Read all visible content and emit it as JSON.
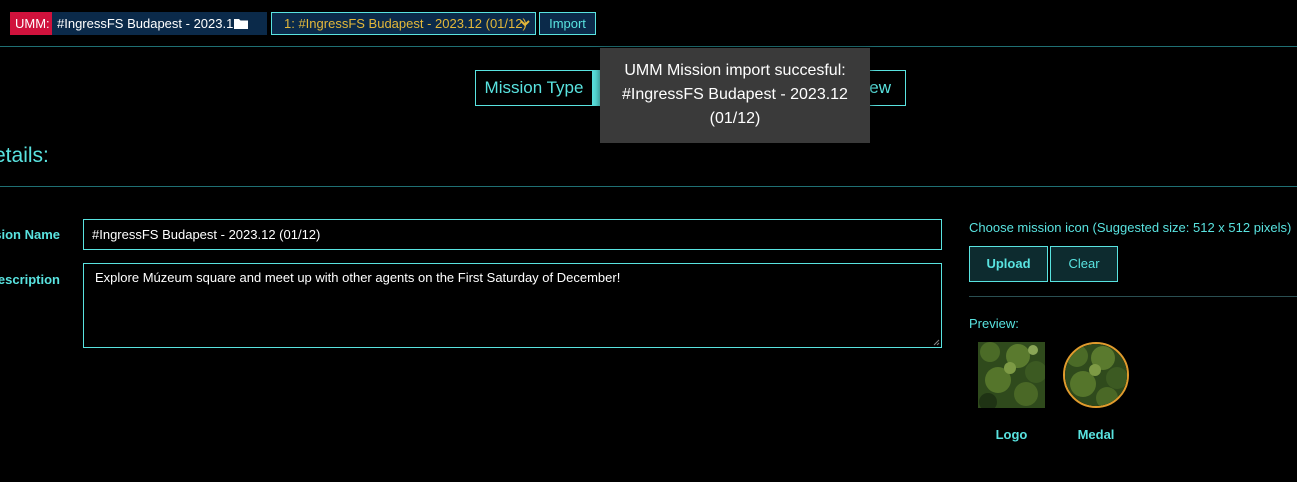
{
  "topbar": {
    "badge": "UMM:",
    "file_name": "#IngressFS Budapest - 2023.12",
    "file_icon": "folder-icon",
    "mission_select_value": "1: #IngressFS Budapest - 2023.12 (01/12)",
    "import_label": "Import"
  },
  "tabs": {
    "mission_type": "Mission Type",
    "preview_partial": "ew"
  },
  "toast": {
    "line1": "UMM Mission import succesful:",
    "line2": "#IngressFS Budapest - 2023.12",
    "line3": "(01/12)"
  },
  "details": {
    "title": "etails:",
    "name_label": "Mission Name",
    "desc_label": "Description",
    "name_value": "#IngressFS Budapest - 2023.12 (01/12)",
    "desc_value": "Explore Múzeum square and meet up with other agents on the First Saturday of December!"
  },
  "icon_panel": {
    "choose_label": "Choose mission icon (Suggested size: 512 x 512 pixels)",
    "upload_label": "Upload",
    "clear_label": "Clear",
    "preview_label": "Preview:",
    "logo_label": "Logo",
    "medal_label": "Medal"
  },
  "colors": {
    "accent": "#59e3e0",
    "badge_red": "#d0123c",
    "select_text": "#e4b83a",
    "medal_ring": "#e09b2d"
  }
}
